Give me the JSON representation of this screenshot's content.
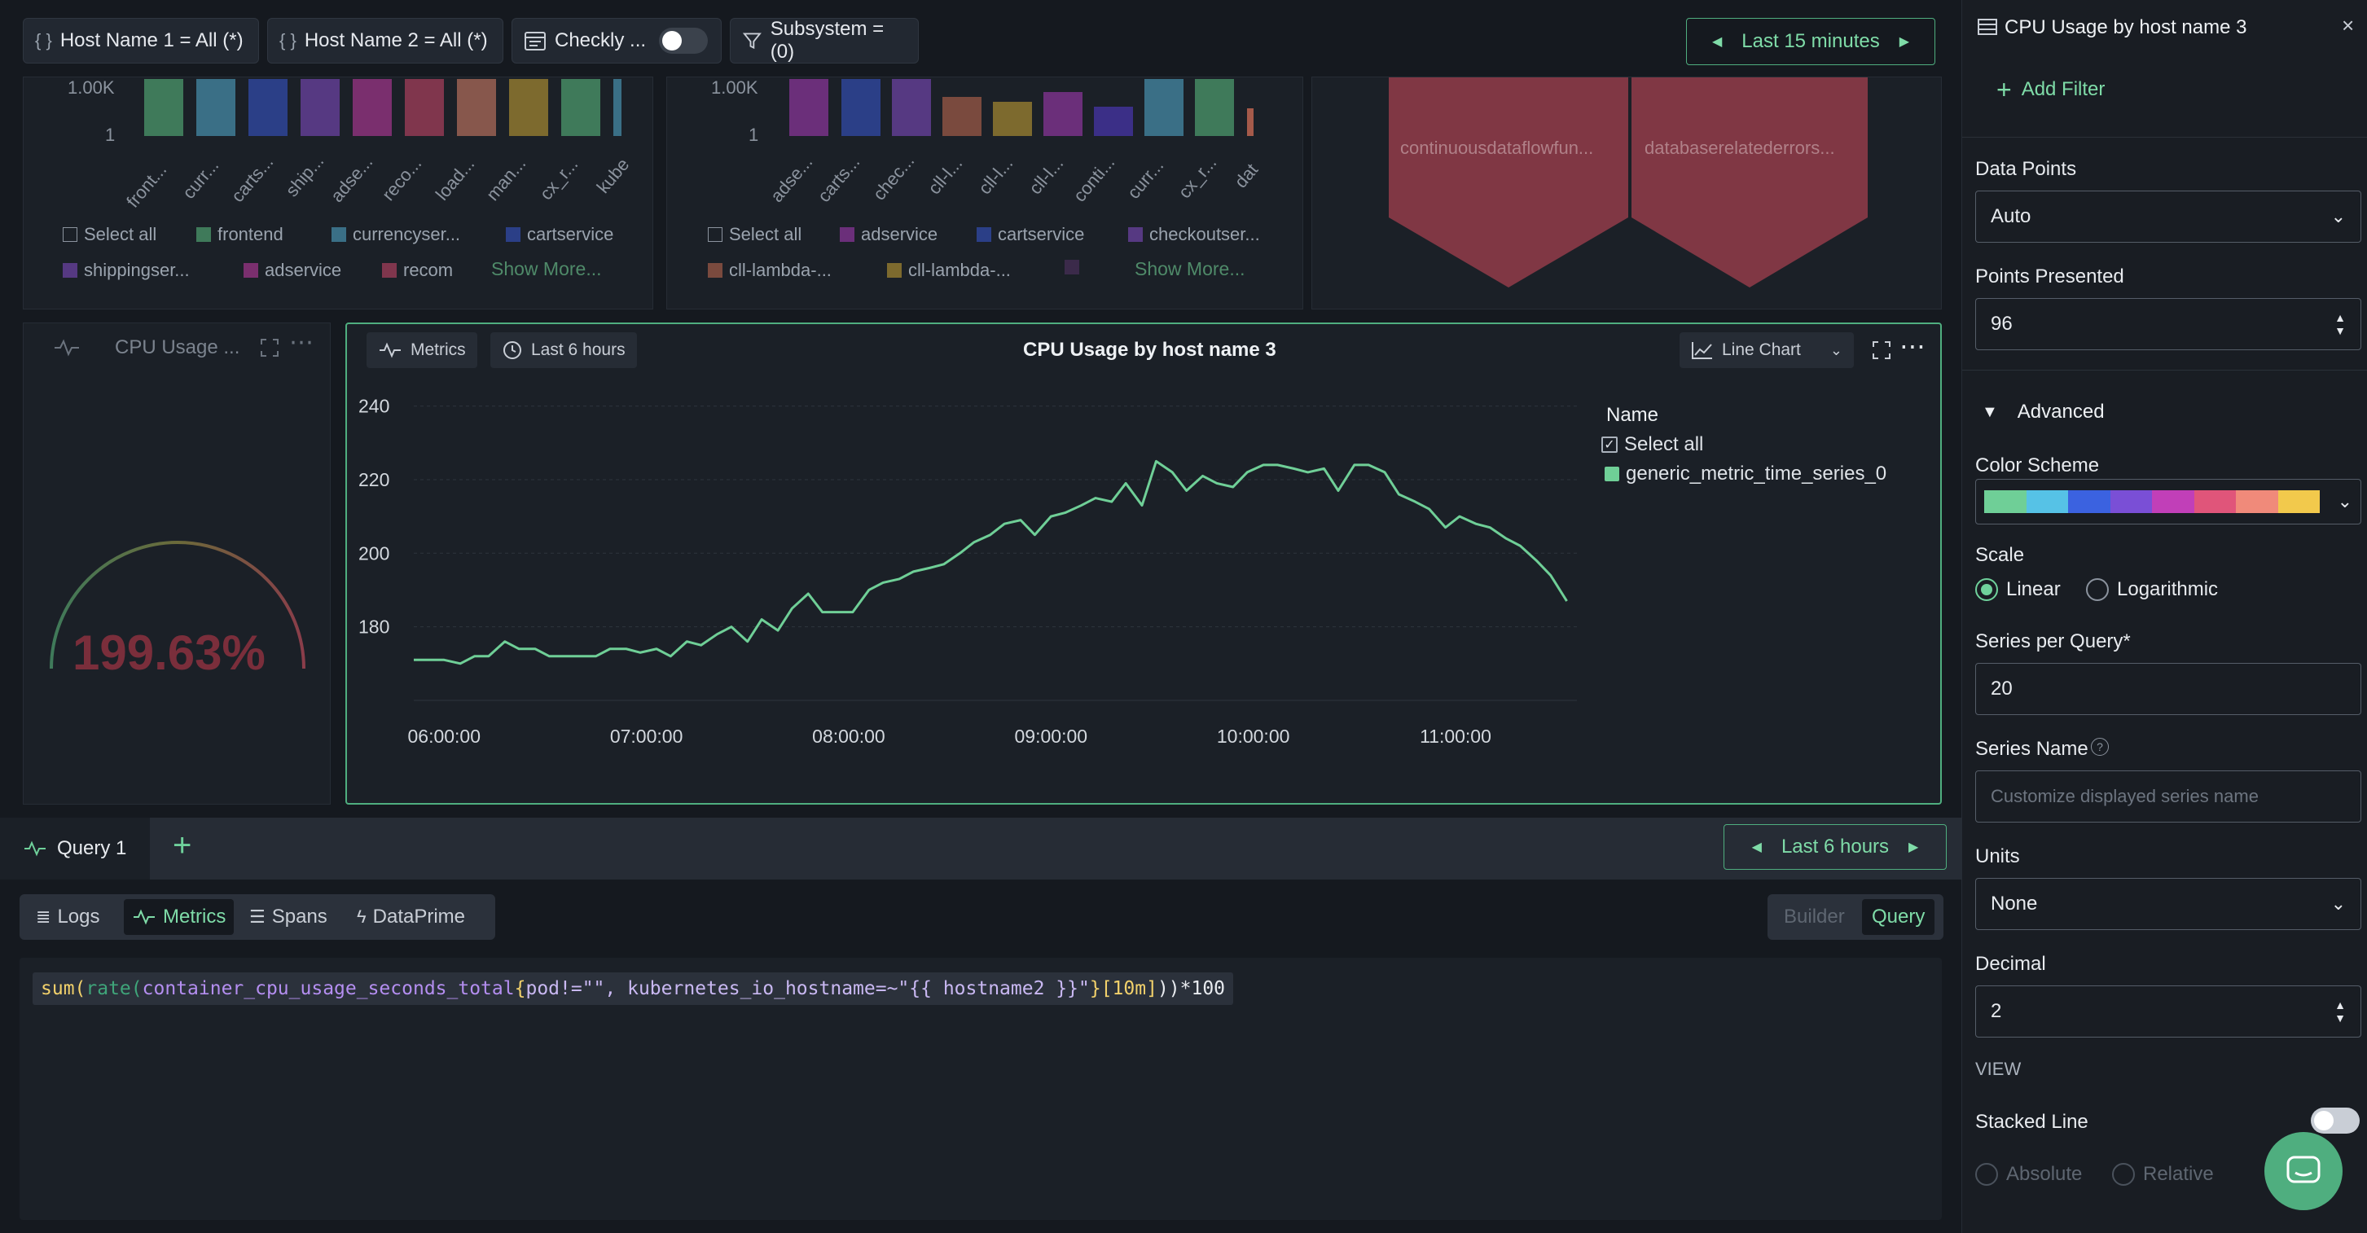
{
  "filters": {
    "host1": "Host Name 1 = All (*)",
    "host2": "Host Name 2 = All (*)",
    "checkly": "Checkly ...",
    "subsystem": "Subsystem = (0)",
    "brace": "{ }"
  },
  "time_range_top": "Last 15 minutes",
  "bg_chart1": {
    "y_top": "1.00K",
    "y_bottom": "1",
    "x_labels": [
      "front...",
      "curr...",
      "carts...",
      "ship...",
      "adse...",
      "reco...",
      "load...",
      "man...",
      "cx_r...",
      "kube"
    ],
    "legend": [
      "Select all",
      "frontend",
      "currencyser...",
      "cartservice",
      "shippingser...",
      "adservice",
      "recom"
    ],
    "show_more": "Show More..."
  },
  "bg_chart2": {
    "y_top": "1.00K",
    "y_bottom": "1",
    "x_labels": [
      "adse...",
      "carts...",
      "chec...",
      "cll-l...",
      "cll-l...",
      "cll-l...",
      "conti...",
      "curr...",
      "cx_r...",
      "dat"
    ],
    "legend": [
      "Select all",
      "adservice",
      "cartservice",
      "checkoutser...",
      "cll-lambda-...",
      "cll-lambda-..."
    ],
    "show_more": "Show More..."
  },
  "bg_chart3": {
    "labels": [
      "continuousdataflowfun...",
      "databaserelatederrors..."
    ]
  },
  "gauge_panel": {
    "title": "CPU Usage ...",
    "value": "199.63%"
  },
  "main_panel": {
    "metrics_label": "Metrics",
    "time_label": "Last 6 hours",
    "title": "CPU Usage by host name 3",
    "chart_type": "Line Chart",
    "legend_title": "Name",
    "legend_select_all": "Select all",
    "series_name": "generic_metric_time_series_0"
  },
  "chart_data": {
    "type": "line",
    "title": "CPU Usage by host name 3",
    "x_ticks": [
      "06:00:00",
      "07:00:00",
      "08:00:00",
      "09:00:00",
      "10:00:00",
      "11:00:00"
    ],
    "y_ticks": [
      240,
      220,
      200,
      180
    ],
    "ylim": [
      160,
      245
    ],
    "xlim_hours": [
      5.85,
      11.6
    ],
    "grid": true,
    "legend_placement": "right",
    "series": [
      {
        "name": "generic_metric_time_series_0",
        "color": "#6fcf97",
        "x": [
          5.85,
          5.93,
          6.0,
          6.08,
          6.15,
          6.22,
          6.3,
          6.37,
          6.45,
          6.52,
          6.6,
          6.67,
          6.75,
          6.82,
          6.9,
          6.97,
          7.05,
          7.12,
          7.2,
          7.27,
          7.35,
          7.42,
          7.5,
          7.57,
          7.65,
          7.72,
          7.8,
          7.87,
          7.95,
          8.02,
          8.1,
          8.17,
          8.25,
          8.32,
          8.4,
          8.47,
          8.55,
          8.62,
          8.7,
          8.77,
          8.85,
          8.92,
          9.0,
          9.07,
          9.15,
          9.22,
          9.3,
          9.37,
          9.45,
          9.52,
          9.6,
          9.67,
          9.75,
          9.82,
          9.9,
          9.97,
          10.05,
          10.12,
          10.2,
          10.27,
          10.35,
          10.42,
          10.5,
          10.57,
          10.65,
          10.72,
          10.8,
          10.87,
          10.95,
          11.02,
          11.1,
          11.17,
          11.25,
          11.32,
          11.4,
          11.47,
          11.55
        ],
        "values": [
          171,
          171,
          171,
          170,
          172,
          172,
          176,
          174,
          174,
          172,
          172,
          172,
          172,
          174,
          174,
          173,
          174,
          172,
          176,
          175,
          178,
          180,
          176,
          182,
          179,
          185,
          189,
          184,
          184,
          184,
          190,
          192,
          193,
          195,
          196,
          197,
          200,
          203,
          205,
          208,
          209,
          205,
          210,
          211,
          213,
          215,
          214,
          219,
          213,
          225,
          222,
          217,
          221,
          219,
          218,
          222,
          224,
          224,
          223,
          222,
          223,
          217,
          224,
          224,
          222,
          216,
          214,
          212,
          207,
          210,
          208,
          207,
          204,
          202,
          198,
          194,
          187
        ]
      }
    ]
  },
  "query_bar": {
    "tab": "Query 1",
    "time_range": "Last 6 hours"
  },
  "query_types": [
    "Logs",
    "Metrics",
    "Spans",
    "DataPrime"
  ],
  "mode": {
    "builder": "Builder",
    "query": "Query"
  },
  "query_code": {
    "fn1": "sum(",
    "fn2": "rate(",
    "metric": "container_cpu_usage_seconds_total",
    "brace_open": "{",
    "labels": "pod!=\"\", kubernetes_io_hostname=~\"{{ hostname2 }}\"",
    "brace_close": "}",
    "range": "[10m]",
    "tail": "))*100"
  },
  "sidebar": {
    "title": "CPU Usage by host name 3",
    "add_filter": "Add Filter",
    "data_points_label": "Data Points",
    "data_points_value": "Auto",
    "points_presented_label": "Points Presented",
    "points_presented_value": "96",
    "advanced": "Advanced",
    "color_scheme_label": "Color Scheme",
    "color_scheme": [
      "#6fcf97",
      "#56c2e6",
      "#3b62e0",
      "#7a4fd6",
      "#c13fb8",
      "#e0557a",
      "#f08a7a",
      "#f2c94c"
    ],
    "scale_label": "Scale",
    "scale_linear": "Linear",
    "scale_log": "Logarithmic",
    "series_per_query_label": "Series per Query*",
    "series_per_query_value": "20",
    "series_name_label": "Series Name",
    "series_name_placeholder": "Customize displayed series name",
    "units_label": "Units",
    "units_value": "None",
    "decimal_label": "Decimal",
    "decimal_value": "2",
    "view_label": "VIEW",
    "stacked_line_label": "Stacked Line",
    "absolute": "Absolute",
    "relative": "Relative"
  }
}
